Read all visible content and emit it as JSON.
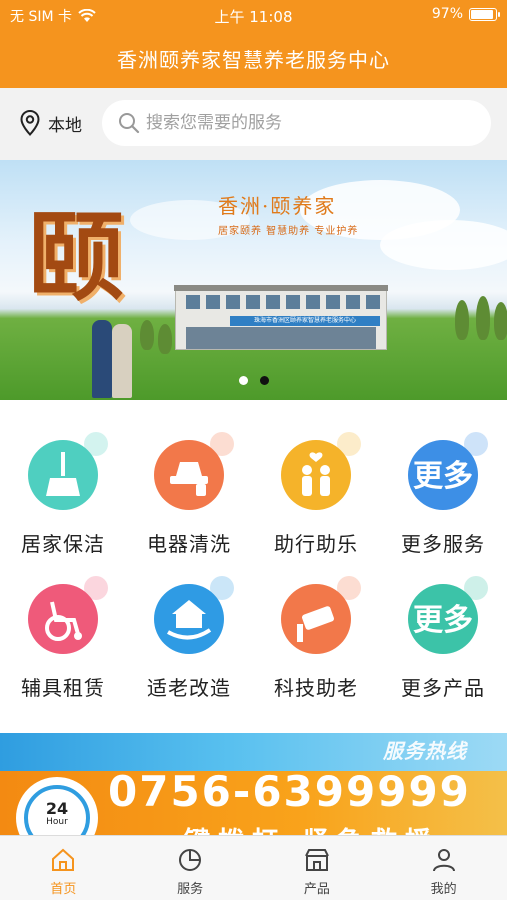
{
  "status_bar": {
    "carrier": "无 SIM 卡",
    "time": "上午 11:08",
    "battery": "97%",
    "battery_level": 0.97
  },
  "header": {
    "title": "香洲颐养家智慧养老服务中心"
  },
  "search": {
    "location": "本地",
    "placeholder": "搜索您需要的服务"
  },
  "banner": {
    "big_char": "颐",
    "brand": "香洲·颐养家",
    "slogan": "居家颐养  智慧助养  专业护养",
    "building_sign": "珠海市香洲区颐养家智慧养老服务中心",
    "slide_count": 2,
    "active_slide": 1
  },
  "services": [
    {
      "label": "居家保洁",
      "icon": "broom-icon",
      "color": "#4fcfc0"
    },
    {
      "label": "电器清洗",
      "icon": "appliance-clean-icon",
      "color": "#f2784a"
    },
    {
      "label": "助行助乐",
      "icon": "helping-hands-icon",
      "color": "#f5b32a"
    },
    {
      "label": "更多服务",
      "icon": "more-services-icon",
      "color": "#3d8fe6"
    },
    {
      "label": "辅具租赁",
      "icon": "wheelchair-icon",
      "color": "#ef5a7a"
    },
    {
      "label": "适老改造",
      "icon": "house-hand-icon",
      "color": "#2f9be4"
    },
    {
      "label": "科技助老",
      "icon": "camera-icon",
      "color": "#f2784a"
    },
    {
      "label": "更多产品",
      "icon": "more-products-icon",
      "color": "#3cc3a8"
    }
  ],
  "hotline": {
    "tag": "服务热线",
    "phone": "0756-6399999",
    "clock_top": "24",
    "clock_bottom": "Hour",
    "subtitle": "一键拨打  紧急救援"
  },
  "tabs": [
    {
      "label": "首页",
      "icon": "home-icon"
    },
    {
      "label": "服务",
      "icon": "service-chart-icon"
    },
    {
      "label": "产品",
      "icon": "store-icon"
    },
    {
      "label": "我的",
      "icon": "user-icon"
    }
  ],
  "colors": {
    "primary": "#f5941e",
    "tab_active": "#f5941e",
    "tab_inactive": "#444444"
  }
}
